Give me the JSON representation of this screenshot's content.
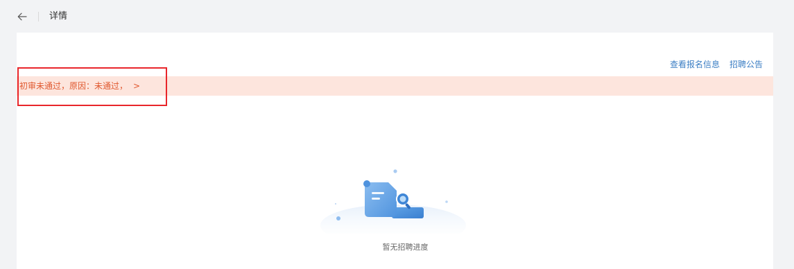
{
  "header": {
    "back_icon": "arrow-left-icon",
    "title": "详情"
  },
  "top_links": {
    "view_registration": "查看报名信息",
    "recruitment_notice": "招聘公告"
  },
  "alert": {
    "text": "初审未通过，原因：未通过，",
    "chevron": ">",
    "colors": {
      "background": "#fde5dd",
      "text": "#e0582e",
      "highlight_border": "#e8252a"
    }
  },
  "empty_state": {
    "icon": "empty-document-illustration",
    "text": "暂无招聘进度"
  },
  "colors": {
    "link": "#3d7fc4",
    "page_background": "#f2f3f5",
    "card_background": "#ffffff"
  }
}
